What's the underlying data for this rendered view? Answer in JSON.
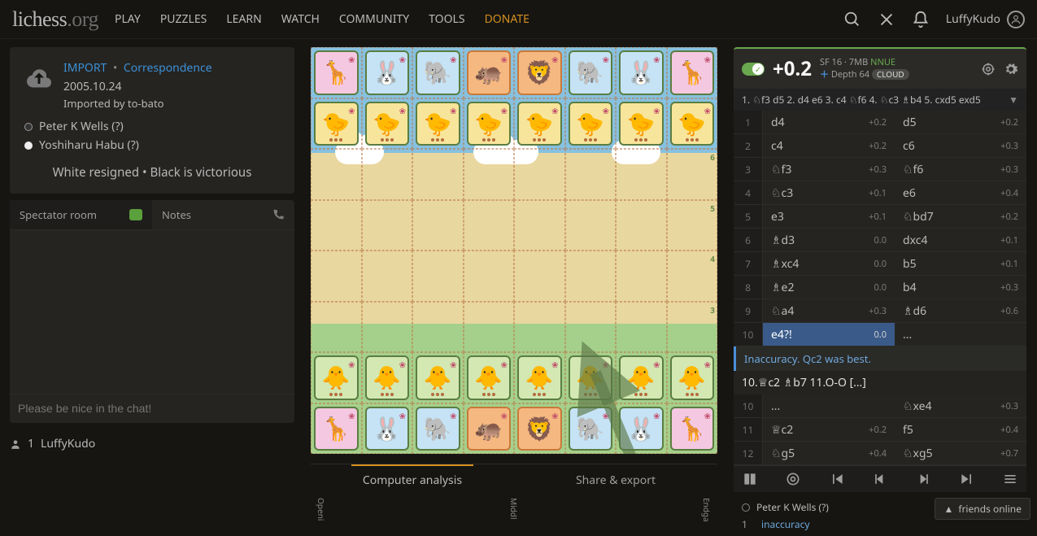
{
  "header": {
    "logo_main": "lichess",
    "logo_tld": ".org",
    "nav": {
      "play": "PLAY",
      "puzzles": "PUZZLES",
      "learn": "LEARN",
      "watch": "WATCH",
      "community": "COMMUNITY",
      "tools": "TOOLS",
      "donate": "DONATE"
    },
    "username": "LuffyKudo"
  },
  "game": {
    "import_label": "IMPORT",
    "corr_label": "Correspondence",
    "separator": "•",
    "date": "2005.10.24",
    "imported_by": "Imported by to-bato",
    "white_player": "Peter K Wells (?)",
    "black_player": "Yoshiharu Habu (?)",
    "result": "White resigned • Black is victorious"
  },
  "chat": {
    "tab_spectator": "Spectator room",
    "tab_notes": "Notes",
    "placeholder": "Please be nice in the chat!"
  },
  "visitors": {
    "count": "1",
    "user": "LuffyKudo"
  },
  "analysis_tabs": {
    "computer": "Computer analysis",
    "share": "Share & export",
    "phases": {
      "open": "Openi",
      "mid": "Middl",
      "end": "Endga"
    }
  },
  "engine": {
    "eval": "+0.2",
    "engine_name": "SF 16 · 7MB",
    "nnue": "NNUE",
    "depth": "Depth 64",
    "cloud": "CLOUD",
    "pv": "1. ♘f3 d5 2. d4 e6 3. c4 ♘f6 4. ♘c3 ♗b4 5. cxd5 exd5"
  },
  "moves": [
    {
      "n": "1",
      "w": "d4",
      "we": "+0.2",
      "b": "d5",
      "be": "+0.2"
    },
    {
      "n": "2",
      "w": "c4",
      "we": "+0.2",
      "b": "c6",
      "be": "+0.3"
    },
    {
      "n": "3",
      "w": "♘f3",
      "we": "+0.3",
      "b": "♘f6",
      "be": "+0.3"
    },
    {
      "n": "4",
      "w": "♘c3",
      "we": "+0.1",
      "b": "e6",
      "be": "+0.4"
    },
    {
      "n": "5",
      "w": "e3",
      "we": "+0.1",
      "b": "♘bd7",
      "be": "+0.2"
    },
    {
      "n": "6",
      "w": "♗d3",
      "we": "0.0",
      "b": "dxc4",
      "be": "+0.1"
    },
    {
      "n": "7",
      "w": "♗xc4",
      "we": "0.0",
      "b": "b5",
      "be": "+0.1"
    },
    {
      "n": "8",
      "w": "♗e2",
      "we": "0.0",
      "b": "b4",
      "be": "+0.3"
    },
    {
      "n": "9",
      "w": "♘a4",
      "we": "+0.3",
      "b": "♗d6",
      "be": "+0.6"
    },
    {
      "n": "10",
      "w": "e4?!",
      "we": "0.0",
      "b": "...",
      "be": "",
      "w_active": true
    }
  ],
  "inaccuracy": {
    "text": "Inaccuracy. Qc2 was best.",
    "variation": "10.♕c2 ♗b7 11.O-O […]"
  },
  "moves_after": [
    {
      "n": "10",
      "w": "...",
      "we": "",
      "b": "♘xe4",
      "be": "+0.3"
    },
    {
      "n": "11",
      "w": "♕c2",
      "we": "+0.2",
      "b": "f5",
      "be": "+0.4"
    },
    {
      "n": "12",
      "w": "♘g5",
      "we": "+0.4",
      "b": "♘xg5",
      "be": "+0.7"
    }
  ],
  "summary": {
    "player": "Peter K Wells (?)",
    "inacc_count": "1",
    "inacc_label": "inaccuracy"
  },
  "friends": {
    "label": "friends online"
  }
}
